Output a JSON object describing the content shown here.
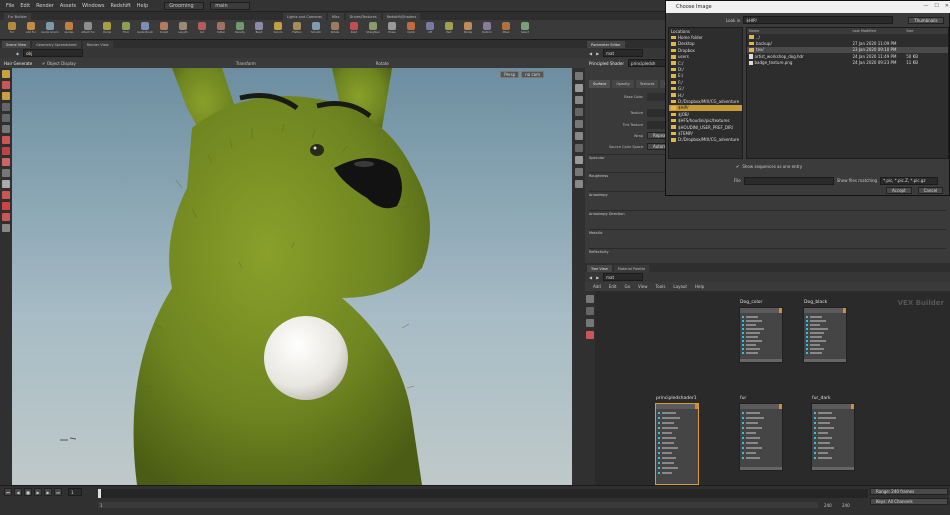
{
  "menubar": {
    "items": [
      "File",
      "Edit",
      "Render",
      "Assets",
      "Windows",
      "Redshift",
      "Help"
    ],
    "desktop": "Grooming",
    "context": "main"
  },
  "shelf": {
    "tabs": [
      "Fur Builder",
      "Lights and Cameras",
      "Misc",
      "Drives/Textures",
      "Redshift/Shaders"
    ],
    "tools": [
      {
        "label": "Fur",
        "color": "#b38a3a"
      },
      {
        "label": "Add Fur",
        "color": "#c48b42"
      },
      {
        "label": "Guide Groom",
        "color": "#7a9aa8"
      },
      {
        "label": "Guides",
        "color": "#c07f40"
      },
      {
        "label": "Attach Fur",
        "color": "#8e8e8e"
      },
      {
        "label": "Clump",
        "color": "#a8a040"
      },
      {
        "label": "Frizz",
        "color": "#8aa050"
      },
      {
        "label": "Guide Brush",
        "color": "#7a8fb3"
      },
      {
        "label": "Sculpt",
        "color": "#b37a5c"
      },
      {
        "label": "Length",
        "color": "#9a8a70"
      },
      {
        "label": "Cut",
        "color": "#b35c5c"
      },
      {
        "label": "Cutter",
        "color": "#a07060"
      },
      {
        "label": "Density",
        "color": "#6e9a6e"
      },
      {
        "label": "Bend",
        "color": "#8a8aa8"
      },
      {
        "label": "Groom",
        "color": "#c0a040"
      },
      {
        "label": "Flatten",
        "color": "#a88a5c"
      },
      {
        "label": "Smooth",
        "color": "#7c9cb0"
      },
      {
        "label": "Rotate",
        "color": "#9c7c5c"
      },
      {
        "label": "Paint",
        "color": "#c05050"
      },
      {
        "label": "Straighten",
        "color": "#8a9a6a"
      },
      {
        "label": "Erase",
        "color": "#999999"
      },
      {
        "label": "Comb",
        "color": "#c06a40"
      },
      {
        "label": "Lift",
        "color": "#7a7aa0"
      },
      {
        "label": "Part",
        "color": "#a0a050"
      },
      {
        "label": "Stroke",
        "color": "#c08a5a"
      },
      {
        "label": "Deform",
        "color": "#8a7a9a"
      },
      {
        "label": "Mask",
        "color": "#b07040"
      },
      {
        "label": "Select",
        "color": "#7aa07a"
      }
    ]
  },
  "viewport": {
    "tabs": [
      "Scene View",
      "Geometry Spreadsheet",
      "Render View"
    ],
    "path": "obj",
    "op_label": "Hair Generate",
    "object_display": "Object Display",
    "transform_label": "Transform",
    "rotate_label": "Rotate",
    "persp_label": "Persp",
    "cam_label": "no cam"
  },
  "params": {
    "tabs": [
      "Parameter Editor"
    ],
    "path": "mat",
    "node_type": "Principled Shader",
    "node_name": "principledsh",
    "subtabs": [
      "Surface",
      "Opacity",
      "Textures",
      "Displacement"
    ],
    "rows": [
      {
        "label": "Base Color",
        "value": ""
      },
      {
        "label": "Texture",
        "value": "Use Texture"
      },
      {
        "label": "Tint Texture",
        "value": ""
      },
      {
        "label": "Wrap",
        "value": "Repeat"
      },
      {
        "label": "Source Color Space",
        "value": "Automatic"
      }
    ],
    "sections": [
      "Specular",
      "Roughness",
      "Anisotropy",
      "Anisotropy Direction",
      "Metallic",
      "Reflectivity"
    ],
    "use_texture": "Use Texture"
  },
  "network": {
    "tabs": [
      "Tree View",
      "Material Palette"
    ],
    "path": "mat",
    "menu": [
      "Add",
      "Edit",
      "Go",
      "View",
      "Tools",
      "Layout",
      "Help"
    ],
    "title": "VEX Builder",
    "nodes": [
      {
        "name": "Dog_color"
      },
      {
        "name": "Dog_black"
      },
      {
        "name": "principledshader1"
      },
      {
        "name": "fur"
      },
      {
        "name": "fur_dark"
      }
    ]
  },
  "dialog": {
    "title": "Choose Image",
    "lookin_label": "Look in",
    "lookin_value": "$HIP/",
    "locations": [
      {
        "label": "Locations",
        "sel": false
      },
      {
        "label": "Home folder",
        "sel": false
      },
      {
        "label": "Desktop",
        "sel": false
      },
      {
        "label": "Dropbox",
        "sel": false
      },
      {
        "label": "users",
        "sel": false
      },
      {
        "label": "C:/",
        "sel": false
      },
      {
        "label": "D:/",
        "sel": false
      },
      {
        "label": "E:/",
        "sel": false
      },
      {
        "label": "F:/",
        "sel": false
      },
      {
        "label": "G:/",
        "sel": false
      },
      {
        "label": "H:/",
        "sel": false
      },
      {
        "label": "D:/Dropbox/MIX/CG_adventure",
        "sel": false
      },
      {
        "label": "$HIP/",
        "sel": true
      },
      {
        "label": "$JOB/",
        "sel": false
      },
      {
        "label": "$HFS/houdini/pic/textures",
        "sel": false
      },
      {
        "label": "$HOUDINI_USER_PREF_DIR/",
        "sel": false
      },
      {
        "label": "$TEMP/",
        "sel": false
      },
      {
        "label": "D:/Dropbox/MIX/CG_adventure",
        "sel": false
      }
    ],
    "columns": [
      "Name",
      "Last Modified",
      "Size"
    ],
    "files": [
      {
        "name": "../",
        "date": "",
        "size": "",
        "sel": false
      },
      {
        "name": "backup/",
        "date": "27 Jan 2020 11:09 PM",
        "size": "",
        "sel": false
      },
      {
        "name": "tex/",
        "date": "23 Jan 2020 09:10 PM",
        "size": "",
        "sel": true
      },
      {
        "name": "artist_workshop_dog.hdr",
        "date": "24 Jan 2020 11:49 PM",
        "size": "50 KB",
        "sel": false
      },
      {
        "name": "badge_texture.png",
        "date": "24 Jan 2020 09:23 PM",
        "size": "11 KB",
        "sel": false
      }
    ],
    "show_sequences": "Show sequences as one entry",
    "file_label": "File",
    "show_matching_label": "Show files matching",
    "pattern": "*.pic, *.pic.Z, *.pic.gz",
    "buttons": {
      "accept": "Accept",
      "cancel": "Cancel",
      "view": "Thumbnails"
    }
  },
  "timeline": {
    "frame": "1",
    "start": "1",
    "end": "240",
    "end2": "240",
    "right_labels": [
      "Range: 240 frames",
      "Keys: All Channels"
    ]
  }
}
